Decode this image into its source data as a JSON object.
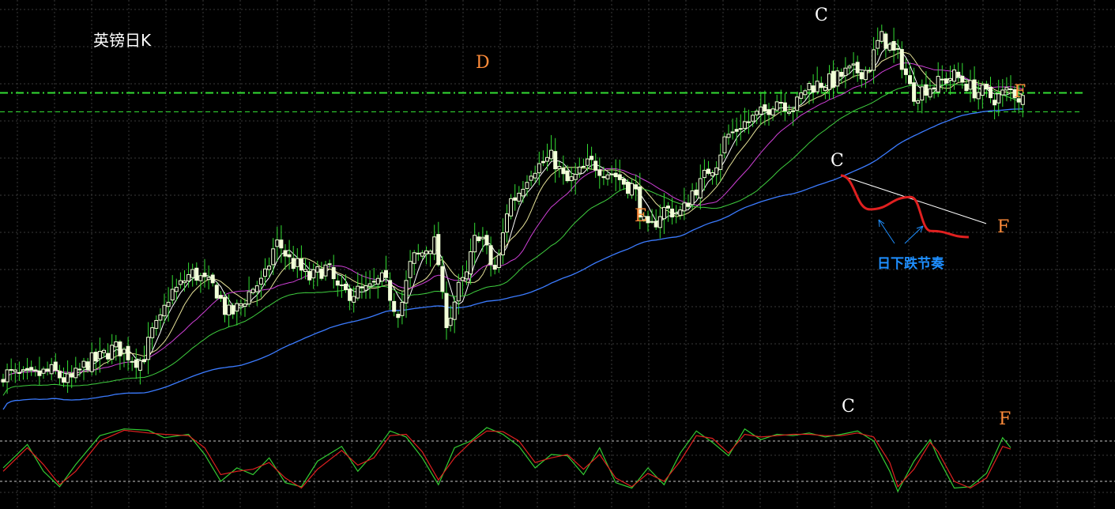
{
  "title": "英镑日K",
  "colors": {
    "background": "#000000",
    "grid": "#3a3a3a",
    "candle": "#f2ffd9",
    "ma_fast": "#ffffff",
    "ma_2": "#e8e49a",
    "ma_3": "#d040d8",
    "ma_4": "#3fcf3f",
    "ma_5": "#3b7bff",
    "level": "#33dd33",
    "osc_k": "#33cc33",
    "osc_d": "#e02020",
    "label_white": "#ffffff",
    "label_orange": "#ff8c3a",
    "schematic_line": "#e02020",
    "rhythm_text": "#1e8fff"
  },
  "labels": {
    "c_top": "C",
    "d": "D",
    "e": "E",
    "f_main": "F",
    "c_schematic": "C",
    "f_schematic": "F",
    "rhythm": "日下跌节奏",
    "c_osc": "C",
    "f_osc": "F"
  },
  "chart_data": [
    {
      "type": "candlestick",
      "title": "英镑日K",
      "x": [
        0,
        1,
        2,
        3,
        4,
        5,
        6,
        7,
        8,
        9,
        10,
        11,
        12,
        13,
        14,
        15,
        16,
        17,
        18,
        19,
        20,
        21,
        22,
        23,
        24,
        25,
        26,
        27,
        28,
        29,
        30,
        31,
        32,
        33,
        34,
        35,
        36,
        37,
        38,
        39,
        40,
        41,
        42,
        43,
        44,
        45,
        46,
        47,
        48,
        49,
        50,
        51,
        52,
        53,
        54,
        55,
        56,
        57,
        58,
        59,
        60,
        61,
        62,
        63,
        64,
        65,
        66,
        67,
        68,
        69,
        70,
        71,
        72,
        73,
        74,
        75,
        76,
        77,
        78,
        79,
        80,
        81,
        82,
        83,
        84,
        85,
        86,
        87,
        88,
        89,
        90,
        91,
        92,
        93,
        94,
        95,
        96,
        97,
        98,
        99,
        100,
        101,
        102,
        103,
        104,
        105,
        106,
        107,
        108,
        109,
        110,
        111,
        112,
        113,
        114,
        115,
        116,
        117,
        118,
        119,
        120,
        121,
        122,
        123,
        124,
        125,
        126,
        127,
        128,
        129,
        130,
        131,
        132,
        133,
        134,
        135,
        136,
        137,
        138,
        139,
        140,
        141,
        142,
        143,
        144,
        145,
        146,
        147,
        148,
        149,
        150,
        151,
        152,
        153,
        154,
        155,
        156,
        157,
        158,
        159,
        160,
        161,
        162,
        163,
        164,
        165,
        166,
        167,
        168,
        169,
        170,
        171,
        172,
        173,
        174,
        175,
        176,
        177,
        178,
        179,
        180,
        181,
        182,
        183,
        184,
        185,
        186,
        187,
        188,
        189,
        190,
        191,
        192,
        193,
        194,
        195,
        196,
        197,
        198,
        199,
        200,
        201,
        202,
        203,
        204,
        205,
        206,
        207,
        208,
        209,
        210,
        211,
        212,
        213,
        214,
        215,
        216,
        217,
        218,
        219,
        220,
        221,
        222,
        223,
        224,
        225,
        226,
        227,
        228,
        229,
        230,
        231,
        232,
        233,
        234,
        235,
        236,
        237,
        238,
        239,
        240,
        241,
        242,
        243,
        244,
        245,
        246,
        247,
        248,
        249,
        250,
        251,
        252,
        253
      ],
      "close_curve": [
        [
          0,
          42
        ],
        [
          6,
          36
        ],
        [
          12,
          45
        ],
        [
          16,
          30
        ],
        [
          22,
          62
        ],
        [
          28,
          83
        ],
        [
          34,
          63
        ],
        [
          38,
          118
        ],
        [
          42,
          176
        ],
        [
          47,
          205
        ],
        [
          52,
          184
        ],
        [
          56,
          140
        ],
        [
          64,
          190
        ],
        [
          68,
          254
        ],
        [
          72,
          222
        ],
        [
          76,
          198
        ],
        [
          80,
          214
        ],
        [
          84,
          173
        ],
        [
          90,
          177
        ],
        [
          94,
          194
        ],
        [
          98,
          146
        ],
        [
          102,
          231
        ],
        [
          107,
          255
        ],
        [
          110,
          130
        ],
        [
          114,
          190
        ],
        [
          118,
          272
        ],
        [
          122,
          212
        ],
        [
          126,
          326
        ],
        [
          132,
          380
        ],
        [
          136,
          394
        ],
        [
          140,
          355
        ],
        [
          146,
          385
        ],
        [
          150,
          372
        ],
        [
          156,
          348
        ],
        [
          160,
          275
        ],
        [
          164,
          310
        ],
        [
          168,
          305
        ],
        [
          172,
          346
        ],
        [
          176,
          381
        ],
        [
          180,
          432
        ],
        [
          184,
          452
        ],
        [
          188,
          466
        ],
        [
          192,
          490
        ],
        [
          196,
          478
        ],
        [
          200,
          513
        ],
        [
          205,
          519
        ],
        [
          210,
          535
        ],
        [
          214,
          538
        ],
        [
          218,
          590
        ],
        [
          222,
          561
        ],
        [
          226,
          500
        ],
        [
          230,
          512
        ],
        [
          236,
          528
        ],
        [
          242,
          503
        ],
        [
          246,
          493
        ],
        [
          250,
          505
        ],
        [
          253,
          490
        ]
      ],
      "ylim": [
        0,
        640
      ],
      "level_lines": [
        501,
        470
      ],
      "annotations": [
        {
          "label": "D",
          "x": 122,
          "y": 423
        },
        {
          "label": "E",
          "x": 162,
          "y": 267
        },
        {
          "label": "C",
          "x": 212,
          "y": 580
        },
        {
          "label": "F",
          "x": 253,
          "y": 490
        }
      ],
      "schematic": {
        "straight_line": [
          [
            0,
            0
          ],
          [
            1,
            1
          ]
        ],
        "rhythm_curve": [
          [
            0,
            0
          ],
          [
            0.2,
            0.55
          ],
          [
            0.48,
            0.35
          ],
          [
            0.62,
            0.9
          ],
          [
            0.88,
            1
          ]
        ]
      }
    },
    {
      "type": "line",
      "series": [
        {
          "values": [
            [
              0,
              40
            ],
            [
              6,
              75
            ],
            [
              10,
              35
            ],
            [
              14,
              12
            ],
            [
              18,
              45
            ],
            [
              24,
              88
            ],
            [
              30,
              98
            ],
            [
              36,
              96
            ],
            [
              40,
              85
            ],
            [
              46,
              90
            ],
            [
              50,
              60
            ],
            [
              54,
              20
            ],
            [
              58,
              40
            ],
            [
              62,
              30
            ],
            [
              66,
              55
            ],
            [
              70,
              18
            ],
            [
              74,
              12
            ],
            [
              78,
              50
            ],
            [
              84,
              72
            ],
            [
              88,
              35
            ],
            [
              92,
              62
            ],
            [
              96,
              95
            ],
            [
              100,
              86
            ],
            [
              104,
              55
            ],
            [
              108,
              15
            ],
            [
              112,
              70
            ],
            [
              116,
              80
            ],
            [
              120,
              100
            ],
            [
              124,
              90
            ],
            [
              128,
              72
            ],
            [
              132,
              40
            ],
            [
              136,
              60
            ],
            [
              140,
              58
            ],
            [
              144,
              30
            ],
            [
              148,
              70
            ],
            [
              152,
              18
            ],
            [
              156,
              10
            ],
            [
              160,
              40
            ],
            [
              164,
              15
            ],
            [
              168,
              62
            ],
            [
              172,
              95
            ],
            [
              176,
              78
            ],
            [
              180,
              58
            ],
            [
              184,
              98
            ],
            [
              188,
              82
            ],
            [
              192,
              90
            ],
            [
              196,
              88
            ],
            [
              200,
              92
            ],
            [
              204,
              86
            ],
            [
              208,
              90
            ],
            [
              212,
              95
            ],
            [
              216,
              80
            ],
            [
              220,
              35
            ],
            [
              222,
              5
            ],
            [
              226,
              50
            ],
            [
              230,
              82
            ],
            [
              232,
              55
            ],
            [
              236,
              10
            ],
            [
              240,
              12
            ],
            [
              244,
              32
            ],
            [
              248,
              85
            ],
            [
              250,
              70
            ]
          ]
        },
        {
          "values": [
            [
              0,
              35
            ],
            [
              6,
              70
            ],
            [
              10,
              45
            ],
            [
              14,
              15
            ],
            [
              18,
              35
            ],
            [
              24,
              80
            ],
            [
              30,
              96
            ],
            [
              36,
              92
            ],
            [
              40,
              90
            ],
            [
              46,
              88
            ],
            [
              50,
              70
            ],
            [
              54,
              30
            ],
            [
              58,
              35
            ],
            [
              62,
              38
            ],
            [
              66,
              48
            ],
            [
              70,
              25
            ],
            [
              74,
              10
            ],
            [
              78,
              38
            ],
            [
              84,
              66
            ],
            [
              88,
              44
            ],
            [
              92,
              55
            ],
            [
              96,
              88
            ],
            [
              100,
              90
            ],
            [
              104,
              64
            ],
            [
              108,
              22
            ],
            [
              112,
              55
            ],
            [
              116,
              78
            ],
            [
              120,
              95
            ],
            [
              124,
              94
            ],
            [
              128,
              80
            ],
            [
              132,
              48
            ],
            [
              136,
              55
            ],
            [
              140,
              60
            ],
            [
              144,
              38
            ],
            [
              148,
              60
            ],
            [
              152,
              25
            ],
            [
              156,
              12
            ],
            [
              160,
              32
            ],
            [
              164,
              20
            ],
            [
              168,
              50
            ],
            [
              172,
              88
            ],
            [
              176,
              84
            ],
            [
              180,
              62
            ],
            [
              184,
              90
            ],
            [
              188,
              86
            ],
            [
              192,
              88
            ],
            [
              196,
              90
            ],
            [
              200,
              90
            ],
            [
              204,
              88
            ],
            [
              208,
              88
            ],
            [
              212,
              92
            ],
            [
              216,
              86
            ],
            [
              220,
              48
            ],
            [
              222,
              12
            ],
            [
              226,
              38
            ],
            [
              230,
              78
            ],
            [
              232,
              64
            ],
            [
              236,
              20
            ],
            [
              240,
              10
            ],
            [
              244,
              25
            ],
            [
              248,
              72
            ],
            [
              250,
              68
            ]
          ]
        }
      ],
      "ylim": [
        0,
        100
      ],
      "reference_lines": [
        80,
        20
      ]
    }
  ]
}
